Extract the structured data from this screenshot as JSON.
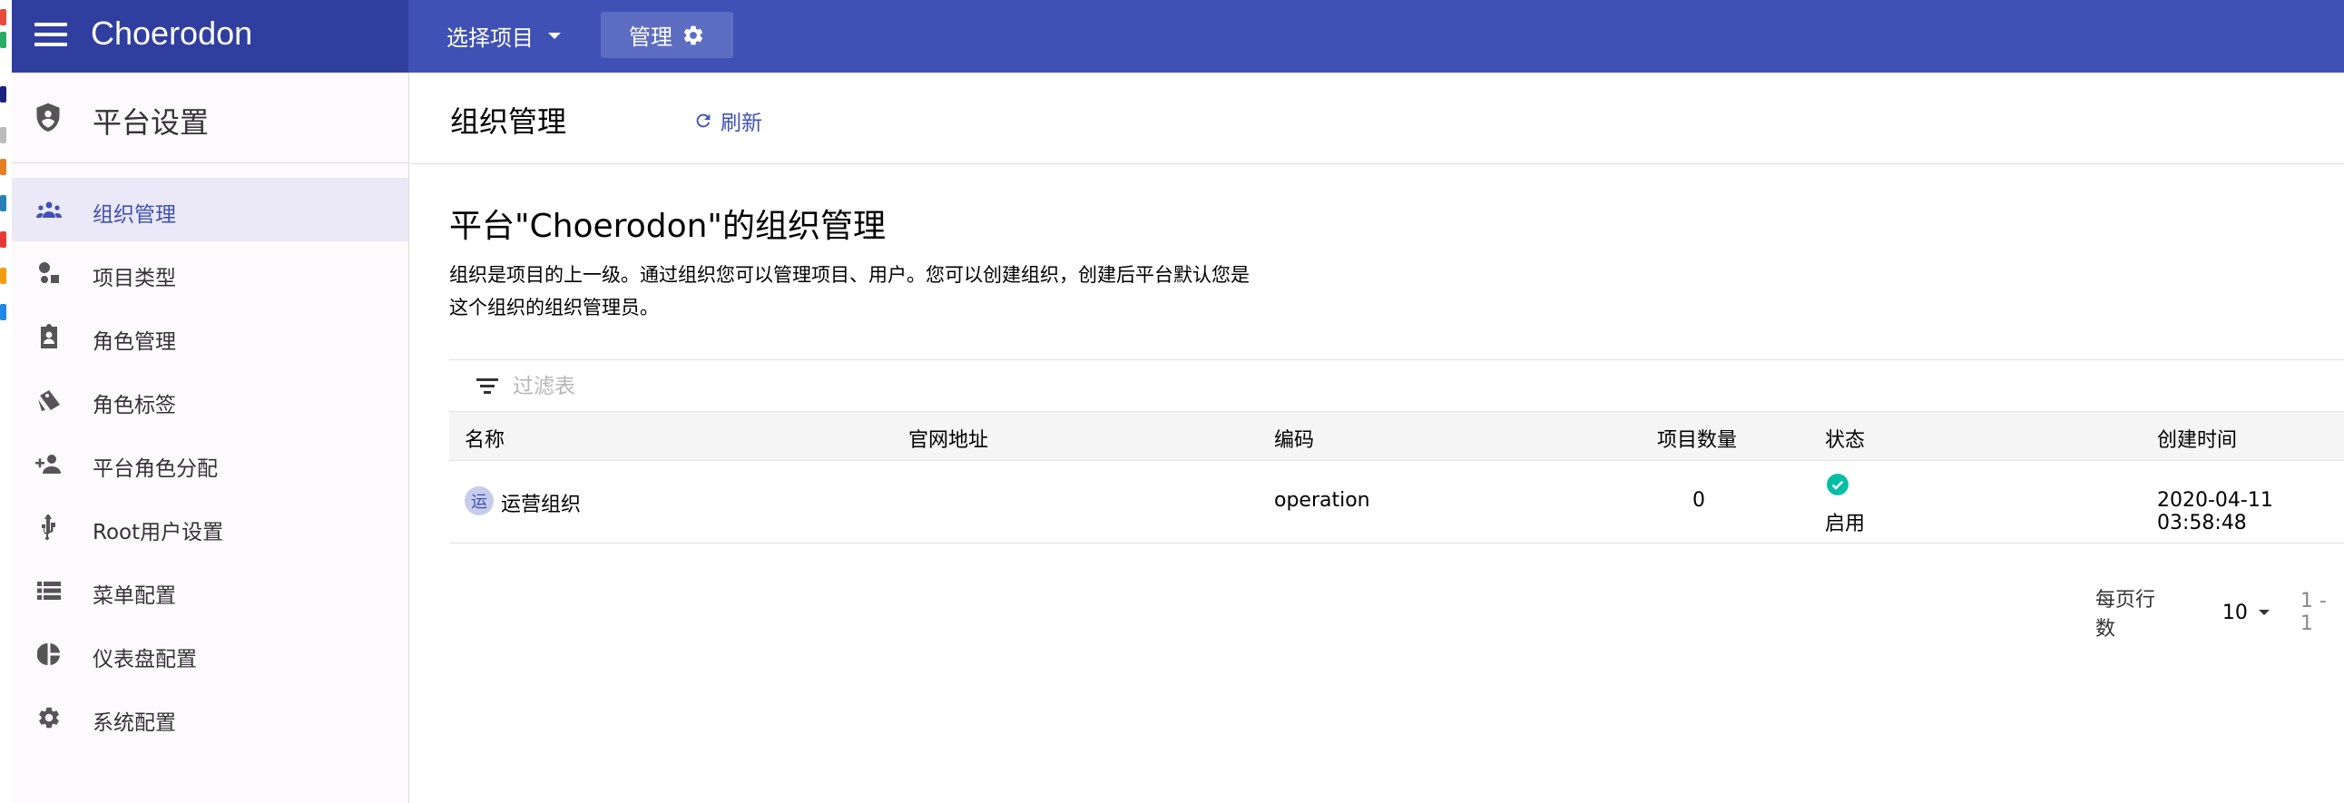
{
  "app": {
    "brand": "Choerodon"
  },
  "header": {
    "project_select": "选择项目",
    "manage_label": "管理"
  },
  "sidebar": {
    "title": "平台设置",
    "items": [
      {
        "label": "组织管理",
        "icon": "people-group-icon",
        "active": true
      },
      {
        "label": "项目类型",
        "icon": "project-type-icon"
      },
      {
        "label": "角色管理",
        "icon": "role-badge-icon"
      },
      {
        "label": "角色标签",
        "icon": "tag-icon"
      },
      {
        "label": "平台角色分配",
        "icon": "person-add-icon"
      },
      {
        "label": "Root用户设置",
        "icon": "usb-icon"
      },
      {
        "label": "菜单配置",
        "icon": "list-icon"
      },
      {
        "label": "仪表盘配置",
        "icon": "pie-chart-icon"
      },
      {
        "label": "系统配置",
        "icon": "gear-icon"
      }
    ]
  },
  "page": {
    "title": "组织管理",
    "refresh_label": "刷新",
    "section_title": "平台\"Choerodon\"的组织管理",
    "description": "组织是项目的上一级。通过组织您可以管理项目、用户。您可以创建组织，创建后平台默认您是这个组织的组织管理员。"
  },
  "table": {
    "filter_placeholder": "过滤表",
    "columns": [
      "名称",
      "官网地址",
      "编码",
      "项目数量",
      "状态",
      "创建时间"
    ],
    "rows": [
      {
        "avatar": "运",
        "name": "运营组织",
        "website": "",
        "code": "operation",
        "project_count": "0",
        "status": "启用",
        "created": "2020-04-11 03:58:48"
      }
    ]
  },
  "pagination": {
    "rows_per_page_label": "每页行数",
    "rows_per_page": "10",
    "range": "1 - 1"
  },
  "colors": {
    "primary": "#3f51b5",
    "brand_dark": "#303f9f",
    "status_enabled": "#00bfa5"
  }
}
